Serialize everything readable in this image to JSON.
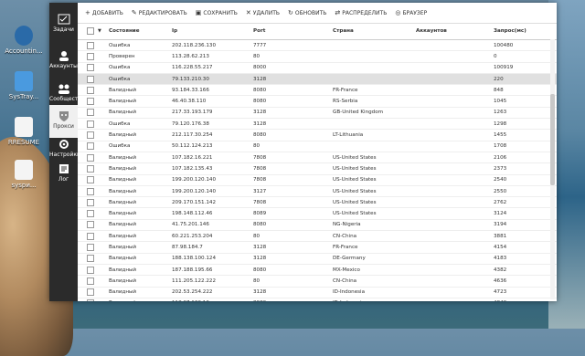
{
  "desktop": {
    "icons": [
      {
        "label": "Accountin..."
      },
      {
        "label": "SysTray..."
      },
      {
        "label": "RRESUME"
      },
      {
        "label": "sysри..."
      }
    ]
  },
  "nav": {
    "items": [
      {
        "label": "Задачи"
      },
      {
        "label": "Аккаунты"
      },
      {
        "label": "Сообщества"
      },
      {
        "label": "Прокси"
      },
      {
        "label": "Настройки"
      },
      {
        "label": "Лог"
      }
    ]
  },
  "toolbar": {
    "add": "ДОБАВИТЬ",
    "edit": "РЕДАКТИРОВАТЬ",
    "save": "СОХРАНИТЬ",
    "delete": "УДАЛИТЬ",
    "refresh": "ОБНОВИТЬ",
    "distribute": "РАСПРЕДЕЛИТЬ",
    "browser": "БРАУЗЕР"
  },
  "table": {
    "columns": [
      "Состояние",
      "Ip",
      "Port",
      "Страна",
      "Аккаунтов",
      "Запрос(мс)"
    ],
    "rows": [
      {
        "state": "Ошибка",
        "ip": "202.118.236.130",
        "port": "7777",
        "country": "",
        "accounts": "",
        "req": "100480"
      },
      {
        "state": "Проверен",
        "ip": "113.28.62.213",
        "port": "80",
        "country": "",
        "accounts": "",
        "req": "0"
      },
      {
        "state": "Ошибка",
        "ip": "116.228.55.217",
        "port": "8000",
        "country": "",
        "accounts": "",
        "req": "100919"
      },
      {
        "state": "Ошибка",
        "ip": "79.133.210.30",
        "port": "3128",
        "country": "",
        "accounts": "",
        "req": "220"
      },
      {
        "state": "Валидный",
        "ip": "93.184.33.166",
        "port": "8080",
        "country": "FR-France",
        "accounts": "",
        "req": "848"
      },
      {
        "state": "Валидный",
        "ip": "46.40.38.110",
        "port": "8080",
        "country": "RS-Serbia",
        "accounts": "",
        "req": "1045"
      },
      {
        "state": "Валидный",
        "ip": "217.33.193.179",
        "port": "3128",
        "country": "GB-United Kingdom",
        "accounts": "",
        "req": "1263"
      },
      {
        "state": "Ошибка",
        "ip": "79.120.176.38",
        "port": "3128",
        "country": "",
        "accounts": "",
        "req": "1298"
      },
      {
        "state": "Валидный",
        "ip": "212.117.30.254",
        "port": "8080",
        "country": "LT-Lithuania",
        "accounts": "",
        "req": "1455"
      },
      {
        "state": "Ошибка",
        "ip": "50.112.124.213",
        "port": "80",
        "country": "",
        "accounts": "",
        "req": "1708"
      },
      {
        "state": "Валидный",
        "ip": "107.182.16.221",
        "port": "7808",
        "country": "US-United States",
        "accounts": "",
        "req": "2106"
      },
      {
        "state": "Валидный",
        "ip": "107.182.135.43",
        "port": "7808",
        "country": "US-United States",
        "accounts": "",
        "req": "2373"
      },
      {
        "state": "Валидный",
        "ip": "199.200.120.140",
        "port": "7808",
        "country": "US-United States",
        "accounts": "",
        "req": "2540"
      },
      {
        "state": "Валидный",
        "ip": "199.200.120.140",
        "port": "3127",
        "country": "US-United States",
        "accounts": "",
        "req": "2550"
      },
      {
        "state": "Валидный",
        "ip": "209.170.151.142",
        "port": "7808",
        "country": "US-United States",
        "accounts": "",
        "req": "2762"
      },
      {
        "state": "Валидный",
        "ip": "198.148.112.46",
        "port": "8089",
        "country": "US-United States",
        "accounts": "",
        "req": "3124"
      },
      {
        "state": "Валидный",
        "ip": "41.75.201.146",
        "port": "8080",
        "country": "NG-Nigeria",
        "accounts": "",
        "req": "3194"
      },
      {
        "state": "Валидный",
        "ip": "60.221.253.204",
        "port": "80",
        "country": "CN-China",
        "accounts": "",
        "req": "3881"
      },
      {
        "state": "Валидный",
        "ip": "87.98.184.7",
        "port": "3128",
        "country": "FR-France",
        "accounts": "",
        "req": "4154"
      },
      {
        "state": "Валидный",
        "ip": "188.138.100.124",
        "port": "3128",
        "country": "DE-Germany",
        "accounts": "",
        "req": "4183"
      },
      {
        "state": "Валидный",
        "ip": "187.188.195.66",
        "port": "8080",
        "country": "MX-Mexico",
        "accounts": "",
        "req": "4382"
      },
      {
        "state": "Валидный",
        "ip": "111.205.122.222",
        "port": "80",
        "country": "CN-China",
        "accounts": "",
        "req": "4636"
      },
      {
        "state": "Валидный",
        "ip": "202.53.254.222",
        "port": "3128",
        "country": "ID-Indonesia",
        "accounts": "",
        "req": "4723"
      },
      {
        "state": "Валидный",
        "ip": "118.97.130.10",
        "port": "8080",
        "country": "ID-Indonesia",
        "accounts": "",
        "req": "4840"
      },
      {
        "state": "Валидный",
        "ip": "120.202.249.230",
        "port": "80",
        "country": "CN-China",
        "accounts": "",
        "req": "5092"
      }
    ],
    "selected_row_label": "Ошибка 79.133.210.30"
  },
  "icons": {
    "tasks": "checklist-icon",
    "accounts": "users-icon",
    "communities": "community-icon",
    "proxy": "mask-icon",
    "settings": "gear-icon",
    "log": "log-icon"
  }
}
